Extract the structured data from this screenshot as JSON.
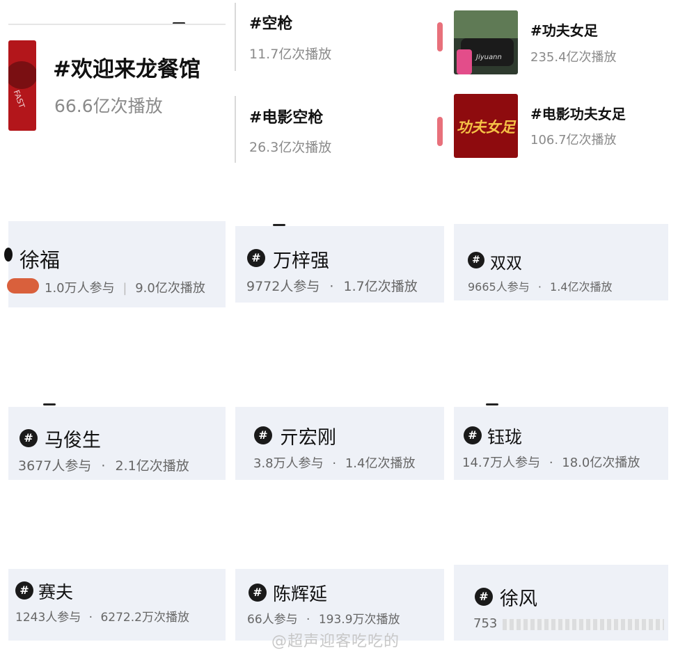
{
  "top_hashtags": {
    "main": {
      "title": "#欢迎来龙餐馆",
      "plays": "66.6亿次播放",
      "thumb_text": "FAST"
    },
    "mid": [
      {
        "title": "#空枪",
        "plays": "11.7亿次播放"
      },
      {
        "title": "#电影空枪",
        "plays": "26.3亿次播放"
      }
    ],
    "right": [
      {
        "title": "#功夫女足",
        "plays": "235.4亿次播放",
        "thumb_text": "Jiyuann"
      },
      {
        "title": "#电影功夫女足",
        "plays": "106.7亿次播放",
        "thumb_text": "功夫女足"
      }
    ]
  },
  "topic_cards": [
    {
      "icon": "#",
      "name": "徐福",
      "participants": "1.0万人参与",
      "sep": "|",
      "plays": "9.0亿次播放"
    },
    {
      "icon": "#",
      "name": "万梓强",
      "participants": "9772人参与",
      "sep": "·",
      "plays": "1.7亿次播放"
    },
    {
      "icon": "#",
      "name": "双双",
      "participants": "9665人参与",
      "sep": "·",
      "plays": "1.4亿次播放"
    },
    {
      "icon": "#",
      "name": "马俊生",
      "participants": "3677人参与",
      "sep": "·",
      "plays": "2.1亿次播放"
    },
    {
      "icon": "#",
      "name": "亓宏刚",
      "participants": "3.8万人参与",
      "sep": "·",
      "plays": "1.4亿次播放"
    },
    {
      "icon": "#",
      "name": "钰珑",
      "participants": "14.7万人参与",
      "sep": "·",
      "plays": "18.0亿次播放"
    },
    {
      "icon": "#",
      "name": "赛夫",
      "participants": "1243人参与",
      "sep": "·",
      "plays": "6272.2万次播放"
    },
    {
      "icon": "#",
      "name": "陈辉延",
      "participants": "66人参与",
      "sep": "·",
      "plays": "193.9万次播放"
    },
    {
      "icon": "#",
      "name": "徐风",
      "participants": "753",
      "sep": "",
      "plays": ""
    }
  ],
  "watermark": "@超声迎客吃吃的",
  "colors": {
    "card_bg": "#eef1f7",
    "accent_pink": "#e8707b",
    "thumb_red": "#b3161b"
  }
}
